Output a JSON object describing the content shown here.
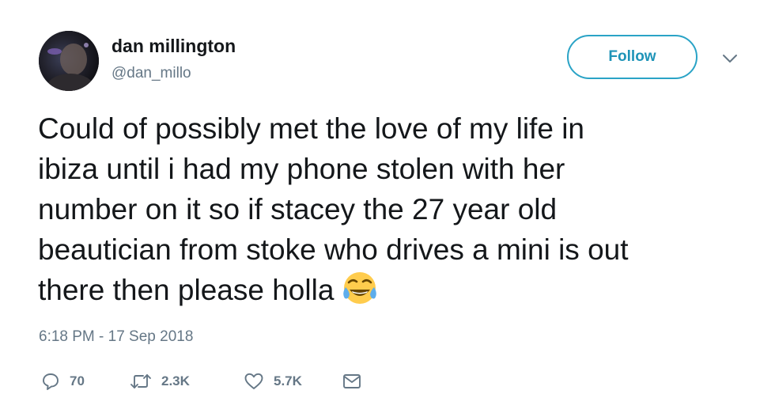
{
  "author": {
    "display_name": "dan millington",
    "handle": "@dan_millo"
  },
  "follow_label": "Follow",
  "tweet": {
    "lines": [
      "Could of possibly met the love of my life in",
      "ibiza until i had my phone stolen with her",
      "number on it so if stacey the 27 year old",
      "beautician from stoke who drives a mini is out",
      "there then please holla"
    ],
    "emoji": "face-with-tears-of-joy",
    "timestamp": "6:18 PM - 17 Sep 2018"
  },
  "actions": {
    "replies": "70",
    "retweets": "2.3K",
    "likes": "5.7K"
  },
  "colors": {
    "accent": "#1da1f2",
    "text": "#14171a",
    "muted": "#657786"
  }
}
